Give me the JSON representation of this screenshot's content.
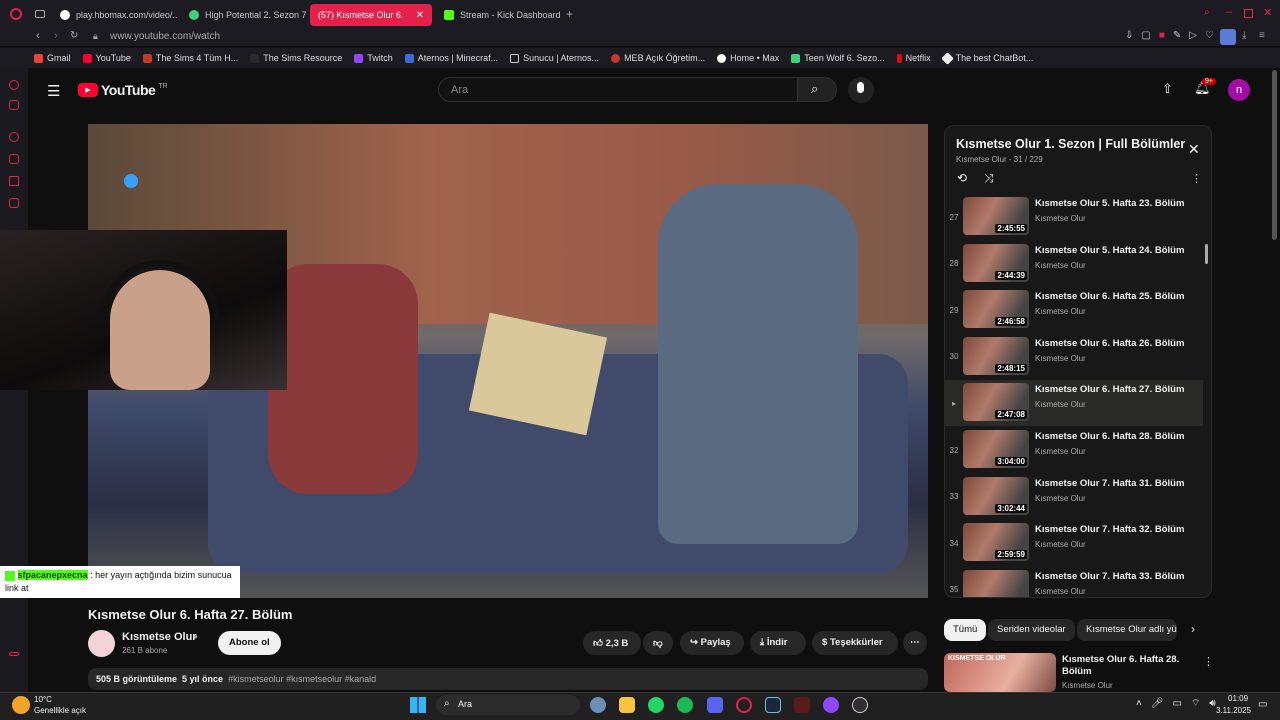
{
  "tabs": [
    {
      "label": "play.hbomax.com/video/..."
    },
    {
      "label": "High Potential 2. Sezon 7"
    },
    {
      "label": "(57) Kısmetse Olur 6."
    },
    {
      "label": "Stream - Kick Dashboard"
    }
  ],
  "address": "www.youtube.com/watch",
  "bookmarks": [
    "Gmail",
    "YouTube",
    "The Sims 4 Tüm H...",
    "The Sims Resource",
    "Twitch",
    "Aternos | Minecraf...",
    "Sunucu | Aternos...",
    "MEB Açık Öğretim...",
    "Home • Max",
    "Teen Wolf 6. Sezo...",
    "Netflix",
    "The best ChatBot..."
  ],
  "youtube": {
    "logo": "YouTube",
    "region": "TR",
    "search_placeholder": "Ara",
    "notif_count": "9+",
    "avatar_letter": "n"
  },
  "chat": {
    "username": "sfpacanepxecna",
    "message": ": her yayın açtığında bizim sunucua link at"
  },
  "video": {
    "title": "Kısmetse Olur 6. Hafta 27. Bölüm",
    "channel": "Kısmetse Olur",
    "subscribers": "261 B abone",
    "subscribe": "Abone ol",
    "likes": "2,3 B",
    "share": "Paylaş",
    "download": "İndir",
    "thanks": "Teşekkürler",
    "views": "505 B görüntüleme",
    "age": "5 yıl önce",
    "tags": "#kismetseolur #kısmetseolur #kanald"
  },
  "playlist": {
    "title": "Kısmetse Olur 1. Sezon | Full Bölümler",
    "subtitle": "Kısmetse Olur - 31 / 229",
    "items": [
      {
        "num": "27",
        "title": "Kısmetse Olur 5. Hafta 23. Bölüm",
        "channel": "Kısmetse Olur",
        "duration": "2:45:55"
      },
      {
        "num": "28",
        "title": "Kısmetse Olur 5. Hafta 24. Bölüm",
        "channel": "Kısmetse Olur",
        "duration": "2:44:39"
      },
      {
        "num": "29",
        "title": "Kısmetse Olur 6. Hafta 25. Bölüm",
        "channel": "Kısmetse Olur",
        "duration": "2:46:58"
      },
      {
        "num": "30",
        "title": "Kısmetse Olur 6. Hafta 26. Bölüm",
        "channel": "Kısmetse Olur",
        "duration": "2:48:15"
      },
      {
        "num": "▸",
        "title": "Kısmetse Olur 6. Hafta 27. Bölüm",
        "channel": "Kısmetse Olur",
        "duration": "2:47:08"
      },
      {
        "num": "32",
        "title": "Kısmetse Olur 6. Hafta 28. Bölüm",
        "channel": "Kısmetse Olur",
        "duration": "3:04:00"
      },
      {
        "num": "33",
        "title": "Kısmetse Olur 7. Hafta 31. Bölüm",
        "channel": "Kısmetse Olur",
        "duration": "3:02:44"
      },
      {
        "num": "34",
        "title": "Kısmetse Olur 7. Hafta 32. Bölüm",
        "channel": "Kısmetse Olur",
        "duration": "2:59:59"
      },
      {
        "num": "35",
        "title": "Kısmetse Olur 7. Hafta 33. Bölüm",
        "channel": "Kısmetse Olur",
        "duration": ""
      }
    ]
  },
  "filters": [
    "Tümü",
    "Seriden videolar",
    "Kısmetse Olur adlı yü"
  ],
  "recommended": {
    "title": "Kısmetse Olur 6. Hafta 28. Bölüm",
    "channel": "Kısmetse Olur",
    "thumb_label": "KISMETSE OLUR"
  },
  "taskbar": {
    "weather_temp": "10°C",
    "weather_desc": "Genellikle açık",
    "search": "Ara",
    "time": "01:09",
    "date": "3.11.2025"
  },
  "colors": {
    "accent": "#e3214b",
    "youtube_red": "#ff0033",
    "kick_green": "#53fc18"
  }
}
